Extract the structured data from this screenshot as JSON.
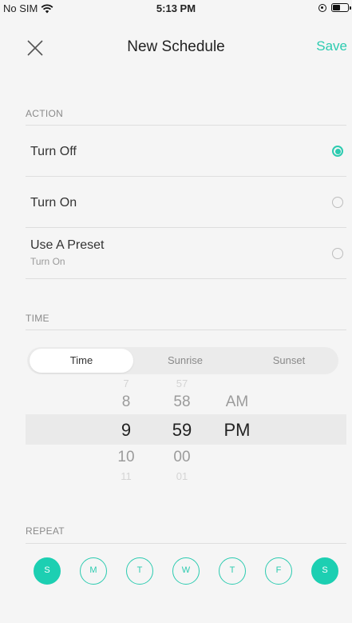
{
  "status": {
    "carrier": "No SIM",
    "time": "5:13 PM",
    "battery_level": 0.55
  },
  "nav": {
    "title": "New Schedule",
    "save_label": "Save"
  },
  "action": {
    "label": "ACTION",
    "options": [
      {
        "label": "Turn Off",
        "selected": true
      },
      {
        "label": "Turn On",
        "selected": false
      },
      {
        "label": "Use A Preset",
        "sublabel": "Turn On",
        "selected": false
      }
    ]
  },
  "time": {
    "label": "TIME",
    "tabs": [
      "Time",
      "Sunrise",
      "Sunset"
    ],
    "active_tab": "Time",
    "hours": [
      "7",
      "8",
      "9",
      "10",
      "11"
    ],
    "minutes": [
      "57",
      "58",
      "59",
      "00",
      "01"
    ],
    "ampm": [
      "AM",
      "PM"
    ],
    "selected": {
      "hour": "9",
      "minute": "59",
      "ampm": "PM"
    }
  },
  "repeat": {
    "label": "REPEAT",
    "days": [
      {
        "label": "S",
        "on": true
      },
      {
        "label": "M",
        "on": false
      },
      {
        "label": "T",
        "on": false
      },
      {
        "label": "W",
        "on": false
      },
      {
        "label": "T",
        "on": false
      },
      {
        "label": "F",
        "on": false
      },
      {
        "label": "S",
        "on": true
      }
    ]
  },
  "colors": {
    "accent": "#2ccbb0",
    "day_selected": "#1ccfb2",
    "background": "#f5f5f5"
  }
}
